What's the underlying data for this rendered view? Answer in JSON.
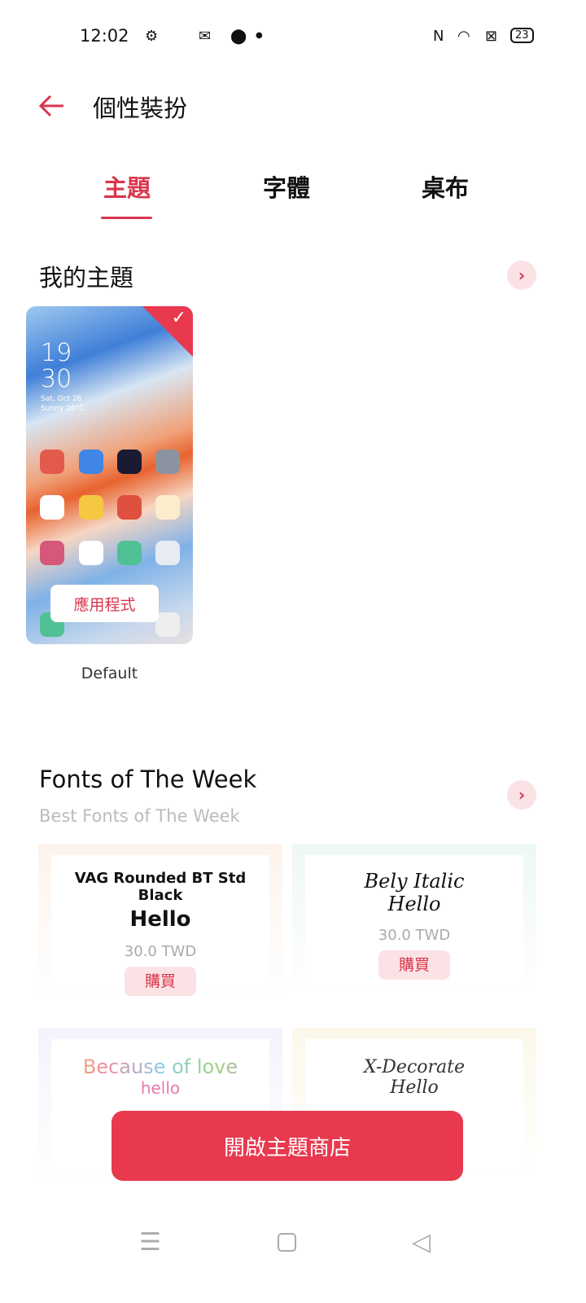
{
  "status": {
    "time": "12:02",
    "battery": "23"
  },
  "header": {
    "title": "個性裝扮"
  },
  "tabs": [
    {
      "label": "主題",
      "active": true
    },
    {
      "label": "字體"
    },
    {
      "label": "桌布"
    }
  ],
  "my_themes": {
    "title": "我的主題",
    "theme": {
      "name": "Default",
      "clock_hour": "19",
      "clock_min": "30",
      "date": "Sat, Oct 26",
      "weather": "Sunny 26°C",
      "apps_button": "應用程式",
      "selected": true
    }
  },
  "fonts": {
    "title": "Fonts of The Week",
    "subtitle": "Best Fonts of The Week",
    "items": [
      {
        "name": "VAG Rounded BT Std Black",
        "sample": "Hello",
        "price": "30.0 TWD",
        "buy": "購買"
      },
      {
        "name": "Bely Italic",
        "sample": "Hello",
        "price": "30.0 TWD",
        "buy": "購買"
      },
      {
        "name": "Because of love",
        "sample": "hello"
      },
      {
        "name": "X-Decorate",
        "sample": "Hello"
      }
    ]
  },
  "store_button": "開啟主題商店",
  "colors": {
    "accent": "#e8394f",
    "accent_light": "#fbe2e5"
  }
}
